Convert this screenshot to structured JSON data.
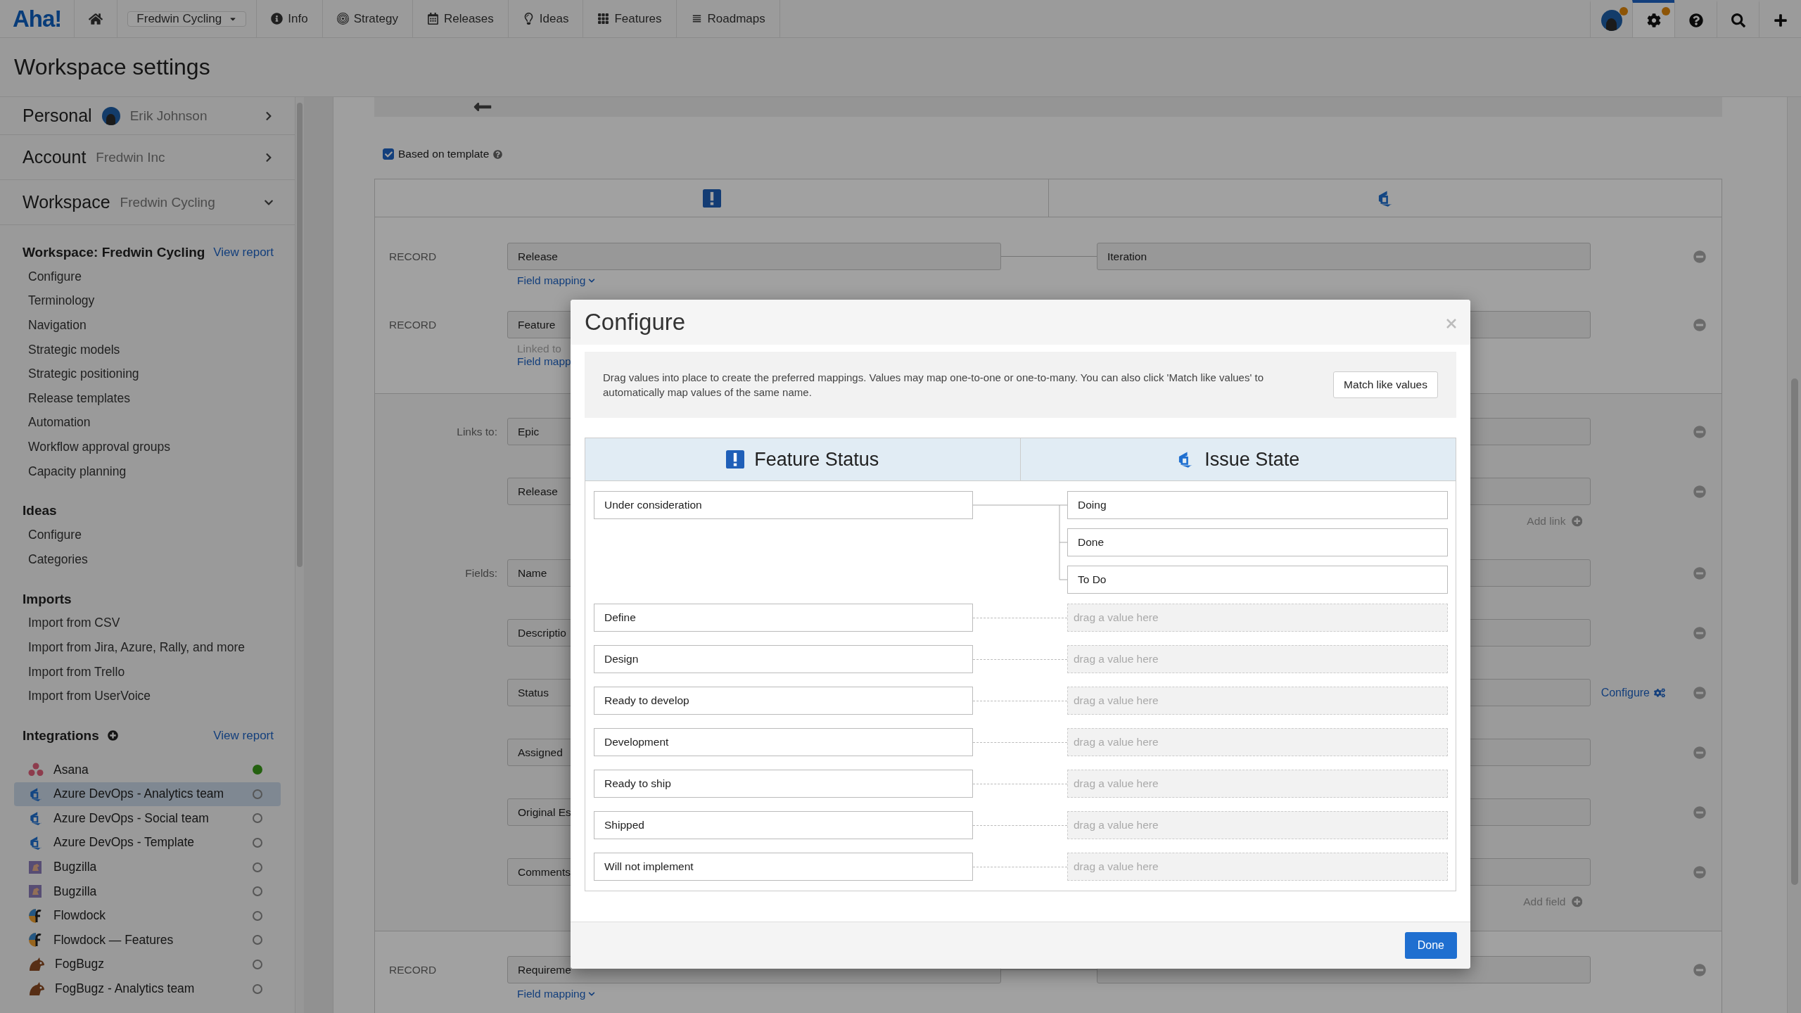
{
  "nav": {
    "logo": "Aha!",
    "workspace": "Fredwin Cycling",
    "items": [
      {
        "label": "Info",
        "kind": "info"
      },
      {
        "label": "Strategy",
        "kind": "strategy"
      },
      {
        "label": "Releases",
        "kind": "releases"
      },
      {
        "label": "Ideas",
        "kind": "ideas"
      },
      {
        "label": "Features",
        "kind": "features"
      },
      {
        "label": "Roadmaps",
        "kind": "roadmaps"
      }
    ],
    "tools": [
      {
        "kind": "avatar",
        "selected": false,
        "badge": true
      },
      {
        "kind": "settings",
        "selected": true,
        "badge": true
      },
      {
        "kind": "help",
        "selected": false,
        "badge": false
      },
      {
        "kind": "search",
        "selected": false,
        "badge": false
      },
      {
        "kind": "add",
        "selected": false,
        "badge": false
      }
    ]
  },
  "page_title": "Workspace settings",
  "sidebar": {
    "sections": [
      {
        "title": "Personal",
        "subtitle": "Erik Johnson",
        "avatar": true,
        "expanded": false
      },
      {
        "title": "Account",
        "subtitle": "Fredwin Inc",
        "avatar": false,
        "expanded": false
      },
      {
        "title": "Workspace",
        "subtitle": "Fredwin Cycling",
        "avatar": false,
        "expanded": true
      }
    ],
    "groups": [
      {
        "title": "Workspace: Fredwin Cycling",
        "link": "View report",
        "items": [
          "Configure",
          "Terminology",
          "Navigation",
          "Strategic models",
          "Strategic positioning",
          "Release templates",
          "Automation",
          "Workflow approval groups",
          "Capacity planning"
        ]
      },
      {
        "title": "Ideas",
        "items": [
          "Configure",
          "Categories"
        ]
      },
      {
        "title": "Imports",
        "items": [
          "Import from CSV",
          "Import from Jira, Azure, Rally, and more",
          "Import from Trello",
          "Import from UserVoice"
        ]
      }
    ],
    "integrations": {
      "title": "Integrations",
      "link": "View report",
      "items": [
        {
          "name": "Asana",
          "kind": "asana",
          "active": true,
          "selected": false
        },
        {
          "name": "Azure DevOps - Analytics team",
          "kind": "azure",
          "active": false,
          "selected": true
        },
        {
          "name": "Azure DevOps - Social team",
          "kind": "azure",
          "active": false,
          "selected": false
        },
        {
          "name": "Azure DevOps - Template",
          "kind": "azure",
          "active": false,
          "selected": false
        },
        {
          "name": "Bugzilla",
          "kind": "bugzilla",
          "active": false,
          "selected": false
        },
        {
          "name": "Bugzilla",
          "kind": "bugzilla",
          "active": false,
          "selected": false
        },
        {
          "name": "Flowdock",
          "kind": "flowdock",
          "active": false,
          "selected": false
        },
        {
          "name": "Flowdock — Features",
          "kind": "flowdock",
          "active": false,
          "selected": false
        },
        {
          "name": "FogBugz",
          "kind": "fogbugz",
          "active": false,
          "selected": false
        },
        {
          "name": "FogBugz - Analytics team",
          "kind": "fogbugz",
          "active": false,
          "selected": false
        }
      ]
    }
  },
  "main": {
    "template": {
      "label": "Based on template",
      "checked": true
    },
    "records": [
      {
        "label": "RECORD",
        "left": "Release",
        "right": "Iteration",
        "link": "Field mapping",
        "caret": true
      },
      {
        "label": "RECORD",
        "left": "Feature",
        "note": "Linked to",
        "link": "Field mapp",
        "caret": false
      }
    ],
    "links": {
      "label": "Links to:",
      "items": [
        {
          "value": "Epic"
        },
        {
          "value": "Release"
        }
      ],
      "add": "Add link"
    },
    "fields": {
      "label": "Fields:",
      "items": [
        {
          "value": "Name"
        },
        {
          "value": "Descriptio"
        },
        {
          "value": "Status",
          "action": "Configure"
        },
        {
          "value": "Assigned"
        },
        {
          "value": "Original Es"
        },
        {
          "value": "Comments"
        }
      ],
      "add": "Add field"
    },
    "bottom_record": {
      "label": "RECORD",
      "left": "Requireme",
      "link": "Field mapping"
    }
  },
  "dialog": {
    "title": "Configure",
    "info": "Drag values into place to create the preferred mappings. Values may map one-to-one or one-to-many. You can also click 'Match like values' to automatically map values of the same name.",
    "match_button": "Match like values",
    "columns": [
      {
        "title": "Feature Status",
        "kind": "aha"
      },
      {
        "title": "Issue State",
        "kind": "azure"
      }
    ],
    "rows": [
      {
        "source": "Under consideration",
        "targets": [
          "Doing",
          "Done",
          "To Do"
        ]
      },
      {
        "source": "Define",
        "placeholder": "drag a value here"
      },
      {
        "source": "Design",
        "placeholder": "drag a value here"
      },
      {
        "source": "Ready to develop",
        "placeholder": "drag a value here"
      },
      {
        "source": "Development",
        "placeholder": "drag a value here"
      },
      {
        "source": "Ready to ship",
        "placeholder": "drag a value here"
      },
      {
        "source": "Shipped",
        "placeholder": "drag a value here"
      },
      {
        "source": "Will not implement",
        "placeholder": "drag a value here"
      }
    ],
    "done": "Done"
  }
}
